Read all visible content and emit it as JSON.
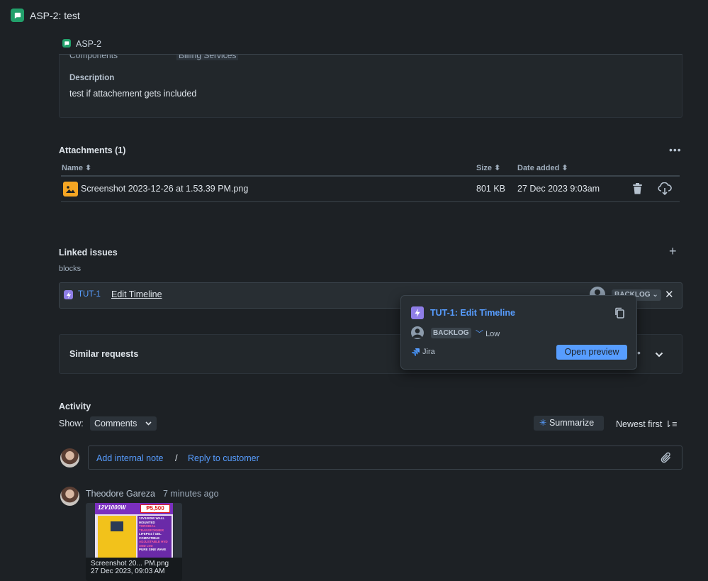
{
  "header": {
    "title": "ASP-2: test",
    "breadcrumb_key": "ASP-2"
  },
  "details": {
    "components_label": "Components",
    "components_value": "Billing Services",
    "description_label": "Description",
    "description_text": "test if attachement gets included"
  },
  "attachments": {
    "title": "Attachments (1)",
    "more_label": "•••",
    "columns": {
      "name": "Name ⬍",
      "size": "Size ⬍",
      "date": "Date added ⬍"
    },
    "rows": [
      {
        "name": "Screenshot 2023-12-26 at 1.53.39 PM.png",
        "size": "801 KB",
        "date": "27 Dec 2023 9:03am"
      }
    ]
  },
  "linked_issues": {
    "title": "Linked issues",
    "add_label": "+",
    "relation": "blocks",
    "items": [
      {
        "key": "TUT-1",
        "summary": "Edit Timeline",
        "status": "BACKLOG"
      }
    ],
    "remove_label": "✕"
  },
  "similar_requests": {
    "title": "Similar requests"
  },
  "popup": {
    "title": "TUT-1: Edit Timeline",
    "status": "BACKLOG",
    "priority": "Low",
    "source": "Jira",
    "open_preview_label": "Open preview"
  },
  "activity": {
    "title": "Activity",
    "show_label": "Show:",
    "show_value": "Comments",
    "summarize_label": "Summarize",
    "sort_label": "Newest first",
    "add_internal_note": "Add internal note",
    "separator": "/",
    "reply_to_customer": "Reply to customer"
  },
  "comment": {
    "author": "Theodore Gareza",
    "time": "7 minutes ago",
    "attachment_name": "Screenshot 20... PM.png",
    "attachment_date": "27 Dec 2023, 09:03 AM"
  },
  "thumbnail_text": {
    "headline_left": "12V1000W",
    "price": "₱5,500",
    "lines": [
      "12V1000W WALL MOUNTED",
      "TOROIDAL TRANSFORMER",
      "LIFEPO4 / GEL COMPATIBLE",
      "ADJUSTABLE HVD AND LVD",
      "PURE SINE WAVE"
    ]
  },
  "colors": {
    "accent": "#579dff",
    "service_green": "#22a06b",
    "story_purple": "#8f7ee7",
    "background": "#1d2125"
  }
}
